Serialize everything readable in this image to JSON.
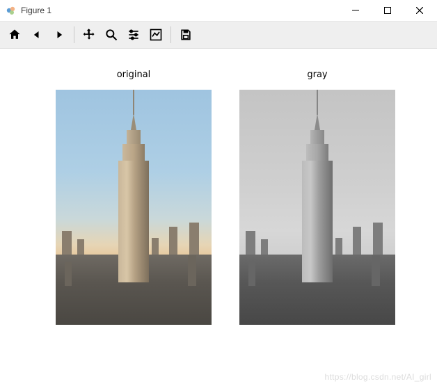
{
  "window": {
    "title": "Figure 1"
  },
  "toolbar": {
    "home": "home-icon",
    "back": "back-icon",
    "forward": "forward-icon",
    "pan": "pan-icon",
    "zoom": "zoom-icon",
    "configure": "configure-subplots-icon",
    "axes": "edit-axes-icon",
    "save": "save-icon"
  },
  "subplots": {
    "left": {
      "title": "original"
    },
    "right": {
      "title": "gray"
    }
  },
  "watermark": "https://blog.csdn.net/AI_girl"
}
